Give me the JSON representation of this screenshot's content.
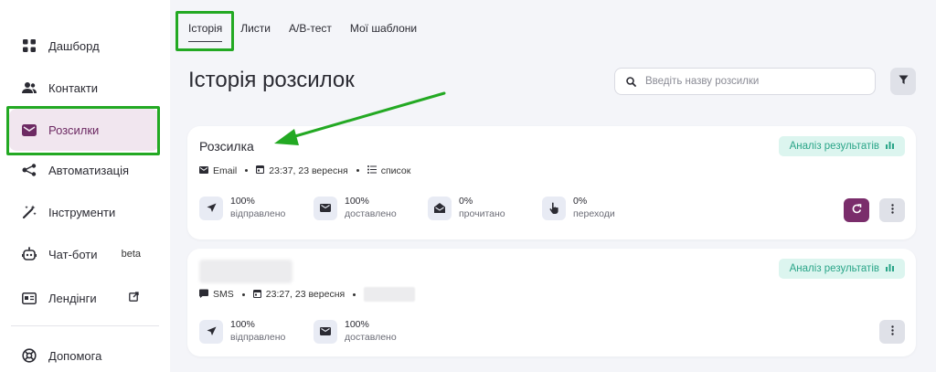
{
  "sidebar": {
    "items": [
      {
        "label": "Дашборд",
        "icon": "dashboard-grid-icon"
      },
      {
        "label": "Контакти",
        "icon": "contacts-people-icon"
      },
      {
        "label": "Розсилки",
        "icon": "mail-icon"
      },
      {
        "label": "Автоматизація",
        "icon": "automation-nodes-icon"
      },
      {
        "label": "Інструменти",
        "icon": "magic-wand-icon"
      },
      {
        "label": "Чат-боти",
        "icon": "robot-icon",
        "badge": "beta"
      },
      {
        "label": "Лендінги",
        "icon": "landing-page-icon"
      },
      {
        "label": "Допомога",
        "icon": "help-lifebuoy-icon"
      }
    ]
  },
  "tabs": [
    "Історія",
    "Листи",
    "A/B-тест",
    "Мої шаблони"
  ],
  "page_title": "Історія розсилок",
  "search": {
    "placeholder": "Введіть назву розсилки"
  },
  "campaigns": [
    {
      "title": "Розсилка",
      "channel": "Email",
      "datetime": "23:37, 23 вересня",
      "list": "список",
      "analyze_label": "Аналіз результатів",
      "stats": [
        {
          "value": "100%",
          "label": "відправлено",
          "icon": "send-icon"
        },
        {
          "value": "100%",
          "label": "доставлено",
          "icon": "envelope-icon"
        },
        {
          "value": "0%",
          "label": "прочитано",
          "icon": "open-envelope-icon"
        },
        {
          "value": "0%",
          "label": "переходи",
          "icon": "pointer-hand-icon"
        }
      ]
    },
    {
      "title": "",
      "channel": "SMS",
      "datetime": "23:27, 23 вересня",
      "analyze_label": "Аналіз результатів",
      "stats": [
        {
          "value": "100%",
          "label": "відправлено",
          "icon": "send-icon"
        },
        {
          "value": "100%",
          "label": "доставлено",
          "icon": "envelope-icon"
        }
      ]
    }
  ],
  "colors": {
    "accent": "#7a2d6b",
    "annotation_green": "#23a923",
    "analyze_bg": "#dcf5ef",
    "analyze_text": "#2aa588"
  }
}
